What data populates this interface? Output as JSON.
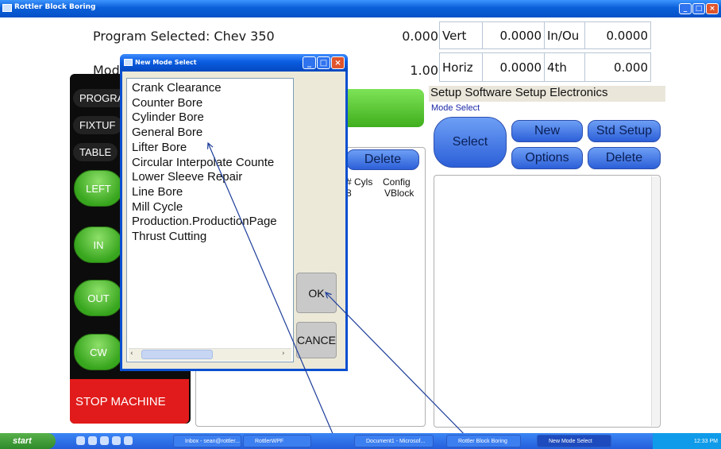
{
  "window": {
    "title": "Rottler Block Boring",
    "controls": [
      "_",
      "□",
      "×"
    ]
  },
  "top": {
    "program_selected": "Program Selected: Chev 350",
    "mode_partial": "Mode",
    "value1": "0.000",
    "value2": "1.00"
  },
  "axes": [
    {
      "label": "Vert",
      "value": "0.0000",
      "label2": "In/Ou",
      "value2": "0.0000"
    },
    {
      "label": "Horiz",
      "value": "0.0000",
      "label2": "4th",
      "value2": "0.000"
    }
  ],
  "left_panel": {
    "tabs": [
      "PROGRA",
      "FIXTUF",
      "TABLE"
    ],
    "buttons": [
      "LEFT",
      "IN",
      "OUT",
      "CW"
    ],
    "stop": "STOP MACHINE"
  },
  "middle": {
    "delete_label": "Delete",
    "columns": [
      "# Cyls",
      "Config"
    ],
    "row": [
      "8",
      "VBlock"
    ]
  },
  "right": {
    "setup_bar": "Setup Software  Setup Electronics",
    "mode_select_label": "Mode Select",
    "select": "Select",
    "new": "New",
    "std_setup": "Std Setup",
    "options": "Options",
    "delete": "Delete"
  },
  "dialog": {
    "title": "New Mode Select",
    "items": [
      "Crank Clearance",
      "Counter Bore",
      "Cylinder Bore",
      "General Bore",
      "Lifter Bore",
      "Circular Interpolate Counte",
      "Lower Sleeve Repair",
      "Line Bore",
      "Mill Cycle",
      "Production.ProductionPage",
      "Thrust Cutting"
    ],
    "ok": "OK",
    "cancel": "CANCE"
  },
  "taskbar": {
    "start": "start",
    "items": [
      "Inbox - sean@rottler...",
      "RottlerWPF",
      "Document1 - Microsof...",
      "Rottler Block Boring",
      "New Mode Select"
    ],
    "clock": "12:33 PM"
  }
}
